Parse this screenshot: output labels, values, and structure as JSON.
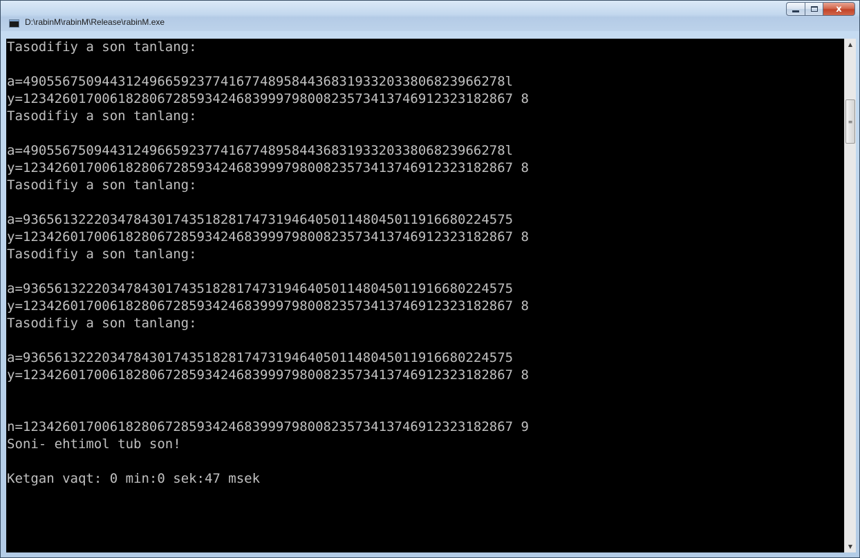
{
  "window": {
    "title": "D:\\rabinM\\rabinM\\Release\\rabinM.exe",
    "caption": {
      "minimize_icon": "minimize-icon",
      "maximize_icon": "maximize-icon",
      "close_label": "x"
    }
  },
  "console": {
    "lines": [
      "Tasodifiy a son tanlang:",
      "",
      "a=4905567509443124966592377416774895844368319332033806823966278l",
      "y=12342601700618280672859342468399979800823573413746912323182867 8",
      "Tasodifiy a son tanlang:",
      "",
      "a=4905567509443124966592377416774895844368319332033806823966278l",
      "y=12342601700618280672859342468399979800823573413746912323182867 8",
      "Tasodifiy a son tanlang:",
      "",
      "a=93656132220347843017435182817473194640501148045011916680224575",
      "y=12342601700618280672859342468399979800823573413746912323182867 8",
      "Tasodifiy a son tanlang:",
      "",
      "a=93656132220347843017435182817473194640501148045011916680224575",
      "y=12342601700618280672859342468399979800823573413746912323182867 8",
      "Tasodifiy a son tanlang:",
      "",
      "a=93656132220347843017435182817473194640501148045011916680224575",
      "y=12342601700618280672859342468399979800823573413746912323182867 8",
      "",
      "",
      "n=12342601700618280672859342468399979800823573413746912323182867 9",
      "Soni- ehtimol tub son!",
      "",
      "Ketgan vaqt: 0 min:0 sek:47 msek"
    ],
    "background": "#000000",
    "foreground": "#c0c0c0"
  },
  "scrollbar": {
    "up_icon": "scroll-up-icon",
    "down_icon": "scroll-down-icon",
    "up_glyph": "▲",
    "down_glyph": "▼",
    "thumb_grip": "≡"
  }
}
